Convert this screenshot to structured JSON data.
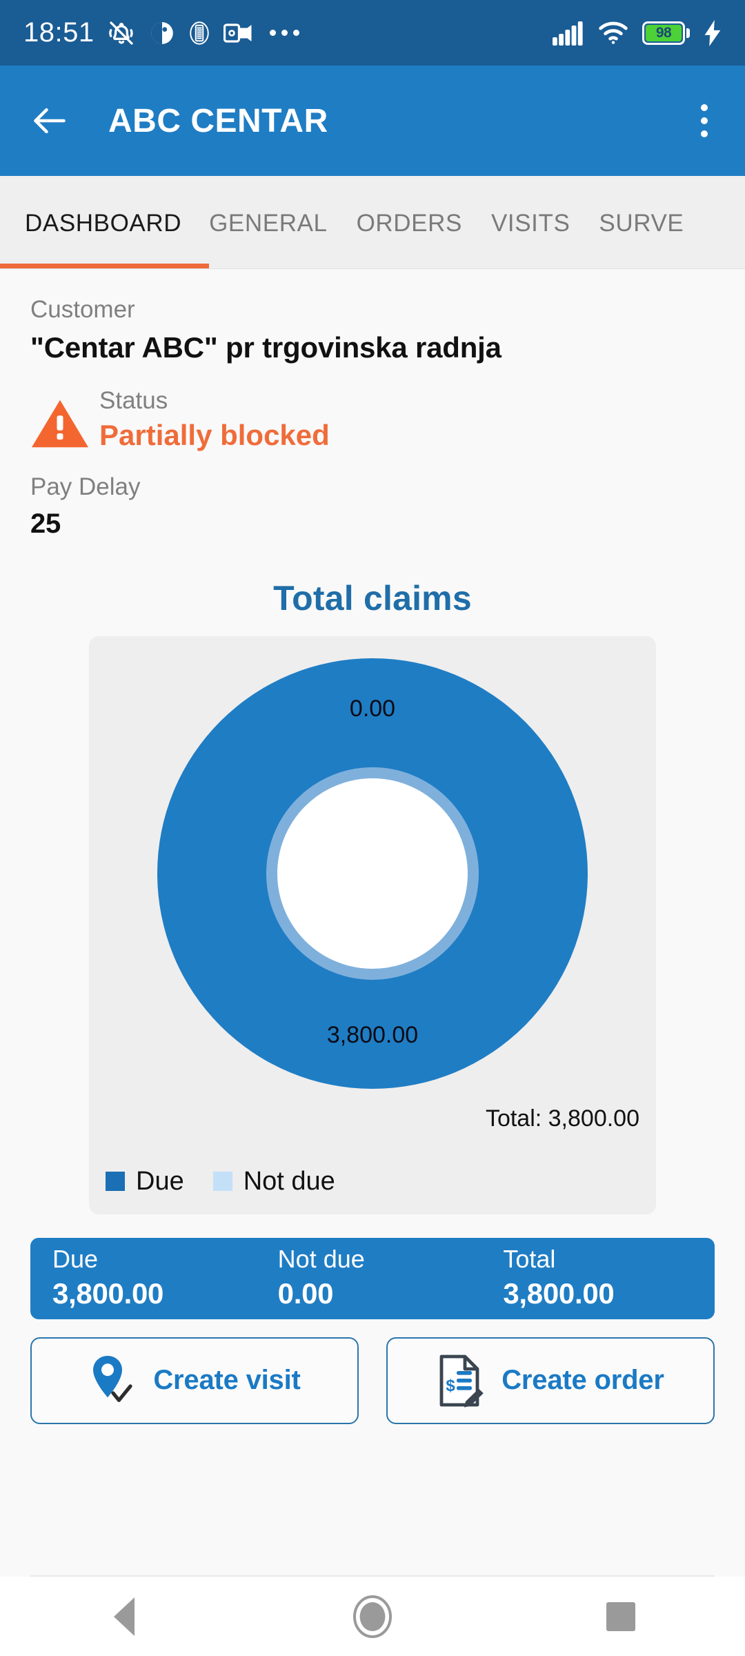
{
  "status_bar": {
    "clock": "18:51",
    "left_icons": [
      "bell-muted-icon",
      "app-circle-icon",
      "app-badge-icon",
      "outlook-icon",
      "overflow-dots-icon"
    ],
    "signal_icon": "cellular-signal-icon",
    "wifi_icon": "wifi-icon",
    "battery_percent": "98",
    "charging_icon": "charging-bolt-icon",
    "background_color": "#1a5c94"
  },
  "app_bar": {
    "back_icon": "back-arrow-icon",
    "title": "ABC CENTAR",
    "menu_icon": "kebab-menu-icon",
    "background_color": "#1f7dc4"
  },
  "tabs": [
    {
      "label": "DASHBOARD",
      "active": true
    },
    {
      "label": "GENERAL",
      "active": false
    },
    {
      "label": "ORDERS",
      "active": false
    },
    {
      "label": "VISITS",
      "active": false
    },
    {
      "label": "SURVE",
      "active": false
    }
  ],
  "tab_indicator_color": "#ef6c3a",
  "customer": {
    "label": "Customer",
    "name": "\"Centar ABC\"  pr trgovinska radnja"
  },
  "status": {
    "icon": "warning-triangle-icon",
    "label": "Status",
    "value": "Partially blocked",
    "color": "#ef6c3a"
  },
  "pay_delay": {
    "label": "Pay Delay",
    "value": "25"
  },
  "chart_data": {
    "type": "pie",
    "title": "Total claims",
    "categories": [
      "Due",
      "Not due"
    ],
    "values": [
      3800.0,
      0.0
    ],
    "value_labels": [
      "3,800.00",
      "0.00"
    ],
    "slice_label_top": "0.00",
    "slice_label_bottom": "3,800.00",
    "total_label": "Total: 3,800.00",
    "total": 3800.0,
    "colors": [
      "#1f7dc4",
      "#bfdff7"
    ],
    "legend": [
      {
        "label": "Due",
        "color": "#1b6fb4"
      },
      {
        "label": "Not due",
        "color": "#c3e0f8"
      }
    ],
    "legend_position": "bottom-left",
    "donut": true,
    "inner_ring_color": "#7fb0dc",
    "hole_color": "#ffffff",
    "card_background": "#eeeeee"
  },
  "summary": {
    "background_color": "#1f7dc4",
    "cells": [
      {
        "label": "Due",
        "value": "3,800.00"
      },
      {
        "label": "Not due",
        "value": "0.00"
      },
      {
        "label": "Total",
        "value": "3,800.00"
      }
    ]
  },
  "actions": [
    {
      "label": "Create visit",
      "icon": "map-pin-check-icon"
    },
    {
      "label": "Create order",
      "icon": "document-invoice-pencil-icon"
    }
  ],
  "nav_bar": {
    "back": "nav-back-triangle-icon",
    "home": "nav-home-circle-icon",
    "recents": "nav-recents-square-icon"
  }
}
